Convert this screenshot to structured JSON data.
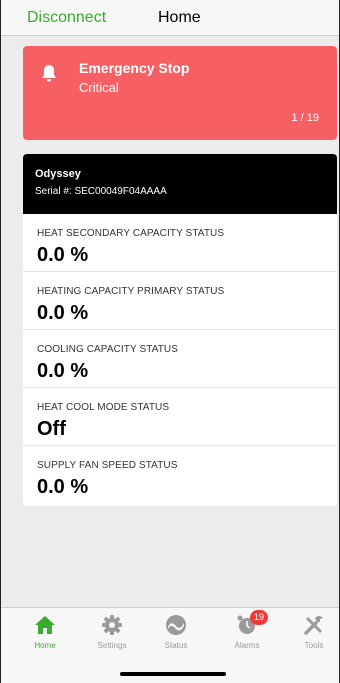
{
  "header": {
    "disconnect_label": "Disconnect",
    "title": "Home"
  },
  "alert": {
    "title": "Emergency Stop",
    "severity": "Critical",
    "pager": "1 / 19",
    "color": "#f65f63",
    "icon": "bell-icon"
  },
  "device": {
    "name": "Odyssey",
    "serial": "Serial #: SEC00049F04AAAA",
    "statuses": [
      {
        "label": "HEAT SECONDARY CAPACITY STATUS",
        "value": "0.0 %"
      },
      {
        "label": "HEATING CAPACITY PRIMARY STATUS",
        "value": "0.0 %"
      },
      {
        "label": "COOLING CAPACITY STATUS",
        "value": "0.0 %"
      },
      {
        "label": "HEAT COOL MODE STATUS",
        "value": "Off"
      },
      {
        "label": "SUPPLY FAN SPEED STATUS",
        "value": "0.0 %"
      }
    ]
  },
  "tabs": [
    {
      "label": "Home",
      "icon": "home-icon",
      "active": true
    },
    {
      "label": "Settings",
      "icon": "gear-icon",
      "active": false
    },
    {
      "label": "Status",
      "icon": "gauge-icon",
      "active": false
    },
    {
      "label": "Alarms",
      "icon": "alarm-clock-icon",
      "active": false,
      "badge": "19"
    },
    {
      "label": "Tools",
      "icon": "tools-icon",
      "active": false
    }
  ],
  "colors": {
    "accent": "#3bab2f",
    "alert": "#f65f63",
    "badge": "#f03a3a"
  }
}
